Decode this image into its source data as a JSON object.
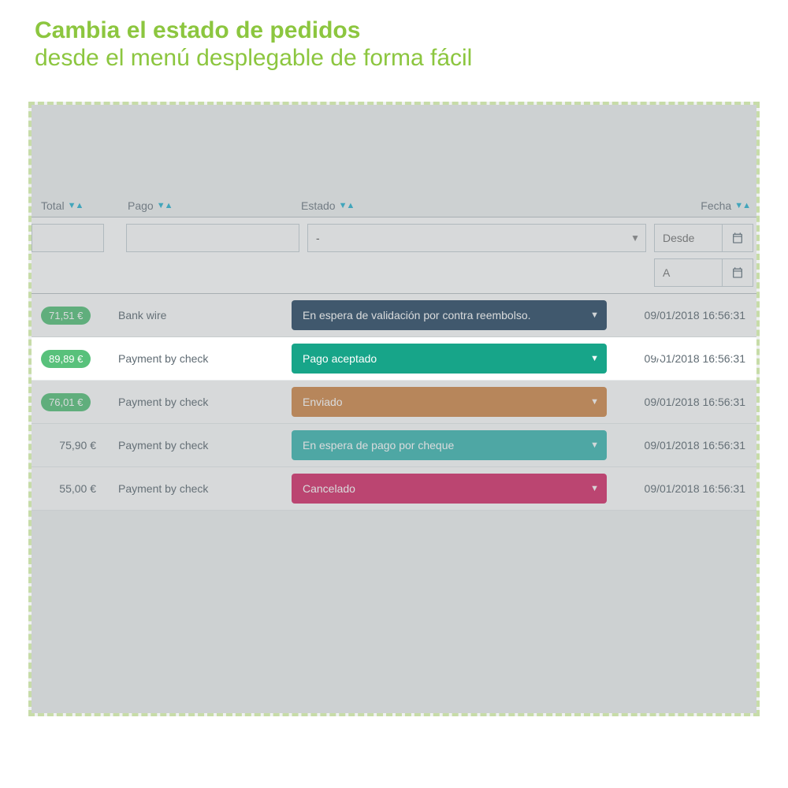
{
  "hero": {
    "title": "Cambia el estado de pedidos",
    "subtitle": "desde el menú desplegable de forma fácil"
  },
  "columns": {
    "total": "Total",
    "pago": "Pago",
    "estado": "Estado",
    "fecha": "Fecha"
  },
  "filters": {
    "estado_placeholder": "-",
    "date_from": "Desde",
    "date_to": "A"
  },
  "rows": [
    {
      "price": "71,51 €",
      "pill": true,
      "payment": "Bank wire",
      "status": "En espera de validación por contra reembolso.",
      "color": "navy",
      "date": "09/01/2018 16:56:31",
      "highlight": false
    },
    {
      "price": "89,89 €",
      "pill": true,
      "payment": "Payment by check",
      "status": "Pago aceptado",
      "color": "teal",
      "date": "09/01/2018 16:56:31",
      "highlight": true
    },
    {
      "price": "76,01 €",
      "pill": true,
      "payment": "Payment by check",
      "status": "Enviado",
      "color": "orange",
      "date": "09/01/2018 16:56:31",
      "highlight": false
    },
    {
      "price": "75,90 €",
      "pill": false,
      "payment": "Payment by check",
      "status": "En espera de pago por cheque",
      "color": "cyan",
      "date": "09/01/2018 16:56:31",
      "highlight": false
    },
    {
      "price": "55,00 €",
      "pill": false,
      "payment": "Payment by check",
      "status": "Cancelado",
      "color": "pink",
      "date": "09/01/2018 16:56:31",
      "highlight": false
    }
  ]
}
